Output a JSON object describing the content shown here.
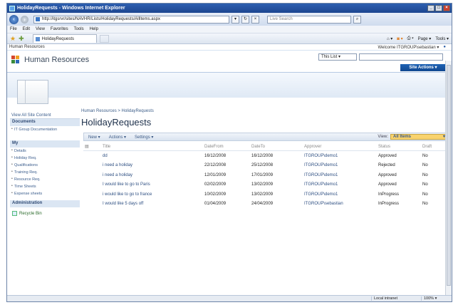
{
  "window": {
    "title": "HolidayRequests - Windows Internet Explorer"
  },
  "addressbar": {
    "url": "http://itgsrvr/sites/NAVHR/Lists/HolidayRequests/AllItems.aspx",
    "refresh": "↻",
    "search_placeholder": "Live Search"
  },
  "menubar": {
    "items": [
      "File",
      "Edit",
      "View",
      "Favorites",
      "Tools",
      "Help"
    ]
  },
  "favorites": {
    "tab_label": "HolidayRequests",
    "tools": [
      "Page ▾",
      "Tools ▾"
    ]
  },
  "sharepoint": {
    "top_link": "Human Resources",
    "welcome": "Welcome ITGROUP\\sebastian ▾",
    "site_title": "Human Resources",
    "search_scope": "This List ▾",
    "site_actions": "Site Actions ▾",
    "breadcrumb": "Human Resources > HolidayRequests",
    "page_title": "HolidayRequests"
  },
  "leftnav": {
    "view_all": "View All Site Content",
    "documents_head": "Documents",
    "documents_items": [
      "IT Group Documentation"
    ],
    "my_head": "My",
    "my_items": [
      "Details",
      "Holiday Req.",
      "Qualifications",
      "Training Req.",
      "Resource Req.",
      "Time Sheets",
      "Expense sheets"
    ],
    "admin_head": "Administration",
    "recycle": "Recycle Bin"
  },
  "toolbar": {
    "new": "New ▾",
    "actions": "Actions ▾",
    "settings": "Settings ▾",
    "view_label": "View:",
    "view_value": "All Items"
  },
  "table": {
    "headers": [
      "Title",
      "DateFrom",
      "DateTo",
      "Approver",
      "Status",
      "Draft"
    ],
    "rows": [
      [
        "dd",
        "16/12/2008",
        "16/12/2008",
        "ITGROUP\\demo1",
        "Approved",
        "No"
      ],
      [
        "i need a holiday",
        "22/12/2008",
        "25/12/2008",
        "ITGROUP\\demo1",
        "Rejected",
        "No"
      ],
      [
        "i need a holiday",
        "12/01/2009",
        "17/01/2009",
        "ITGROUP\\demo1",
        "Approved",
        "No"
      ],
      [
        "I would like to go to Paris",
        "02/02/2009",
        "13/02/2009",
        "ITGROUP\\demo1",
        "Approved",
        "No"
      ],
      [
        "i would like to go to france",
        "10/02/2009",
        "13/02/2009",
        "ITGROUP\\demo1",
        "InProgress",
        "No"
      ],
      [
        "I would like 5 days off",
        "01/04/2009",
        "24/04/2009",
        "ITGROUP\\sebastian",
        "InProgress",
        "No"
      ]
    ]
  },
  "statusbar": {
    "zone": "Local intranet",
    "zoom": "100% ▾"
  }
}
